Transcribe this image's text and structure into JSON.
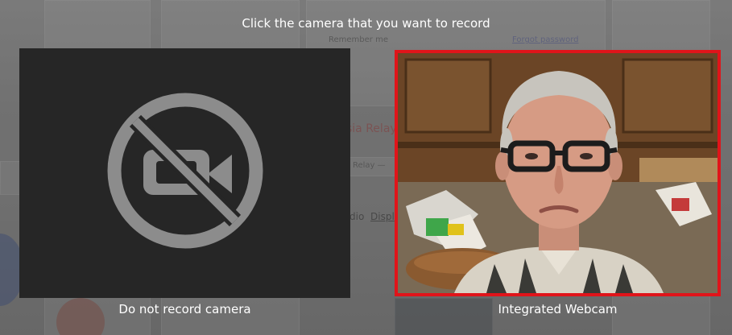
{
  "dialog": {
    "prompt": "Click the camera that you want to record",
    "selected_color": "#e0141a"
  },
  "cameras": [
    {
      "label": "Do not record camera",
      "icon": "camera-off-icon",
      "selected": false
    },
    {
      "label": "Integrated Webcam",
      "selected": true
    }
  ],
  "background_app": {
    "remember_me": "Remember me",
    "forgot_password": "Forgot password",
    "brand_fragment": "sia Relay",
    "dropdown_fragment": "Relay —",
    "tab_fragment_1": "dio",
    "tab_fragment_2": "Displ"
  }
}
